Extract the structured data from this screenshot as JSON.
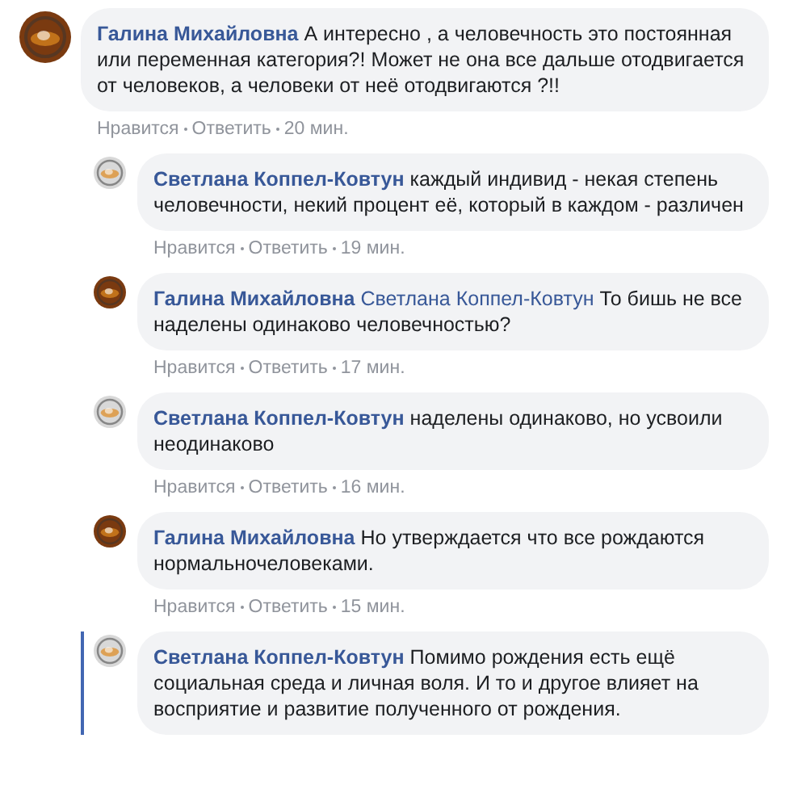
{
  "comments": [
    {
      "author": "Галина Михайловна",
      "color": "#7a3a10",
      "reply": false,
      "highlighted": false,
      "text": "А интересно , а человечность это постоянная или переменная категория?! Может не она все дальше отодвигается от человеков, а человеки от неё отодвигаются ?!!",
      "actions": [
        "Нравится",
        "Ответить",
        "20 мин."
      ]
    },
    {
      "author": "Светлана Коппел-Ковтун",
      "color": "#d8d8d8",
      "reply": true,
      "highlighted": false,
      "text": "каждый индивид - некая степень человечности, некий процент её, который в каждом - различен",
      "actions": [
        "Нравится",
        "Ответить",
        "19 мин."
      ]
    },
    {
      "author": "Галина Михайловна",
      "color": "#7a3a10",
      "reply": true,
      "highlighted": false,
      "mention": "Светлана Коппел-Ковтун",
      "text": "То бишь не все наделены одинаково человечностью?",
      "actions": [
        "Нравится",
        "Ответить",
        "17 мин."
      ]
    },
    {
      "author": "Светлана Коппел-Ковтун",
      "color": "#d8d8d8",
      "reply": true,
      "highlighted": false,
      "text": "наделены одинаково, но усвоили неодинаково",
      "actions": [
        "Нравится",
        "Ответить",
        "16 мин."
      ]
    },
    {
      "author": "Галина Михайловна",
      "color": "#7a3a10",
      "reply": true,
      "highlighted": false,
      "text": "Но утверждается что все рождаются нормальночеловеками.",
      "actions": [
        "Нравится",
        "Ответить",
        "15 мин."
      ]
    },
    {
      "author": "Светлана Коппел-Ковтун",
      "color": "#d8d8d8",
      "reply": true,
      "highlighted": true,
      "text": "Помимо рождения есть ещё социальная среда и личная воля. И то и другое влияет на восприятие и развитие полученного от рождения."
    }
  ]
}
